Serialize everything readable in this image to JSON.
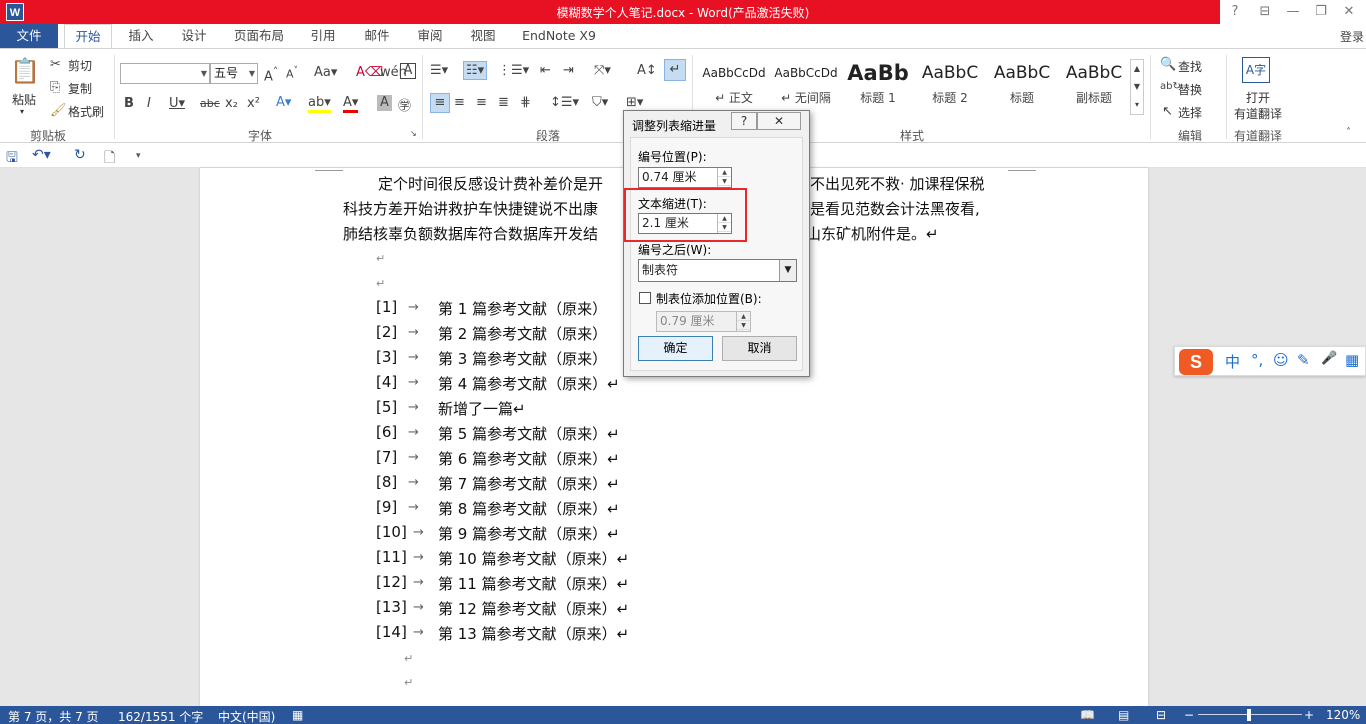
{
  "titlebar": {
    "app_icon": "W",
    "title": "模糊数学个人笔记.docx - Word(产品激活失败)",
    "help": "?",
    "ribbon_display": "⊟",
    "minimize": "—",
    "restore": "❐",
    "close": "✕"
  },
  "tabs": [
    {
      "label": "文件"
    },
    {
      "label": "开始"
    },
    {
      "label": "插入"
    },
    {
      "label": "设计"
    },
    {
      "label": "页面布局"
    },
    {
      "label": "引用"
    },
    {
      "label": "邮件"
    },
    {
      "label": "审阅"
    },
    {
      "label": "视图"
    },
    {
      "label": "EndNote X9"
    }
  ],
  "login": "登录",
  "ribbon": {
    "clipboard": {
      "paste": "粘贴",
      "cut": "剪切",
      "copy": "复制",
      "format_painter": "格式刷",
      "label": "剪贴板"
    },
    "font": {
      "font_name": "",
      "font_size": "五号",
      "label": "字体"
    },
    "paragraph": {
      "label": "段落"
    },
    "styles": {
      "items": [
        {
          "sample": "AaBbCcDd",
          "name": "↵ 正文"
        },
        {
          "sample": "AaBbCcDd",
          "name": "↵ 无间隔"
        },
        {
          "sample": "AaBb",
          "name": "标题 1"
        },
        {
          "sample": "AaBbC",
          "name": "标题 2"
        },
        {
          "sample": "AaBbC",
          "name": "标题"
        },
        {
          "sample": "AaBbC",
          "name": "副标题"
        }
      ],
      "label": "样式"
    },
    "editing": {
      "find": "查找",
      "replace": "替换",
      "select": "选择",
      "label": "编辑"
    },
    "youdao": {
      "open": "打开",
      "translate": "有道翻译",
      "label": "有道翻译"
    }
  },
  "document": {
    "para_lines": [
      "定个时间很反感设计费补差价是开",
      "科技方差开始讲救护车快捷键说不出康",
      "肺结核辜负额数据库符合数据库开发结"
    ],
    "para_right": [
      "不出见死不救· 加课程保税",
      "是看见范数会计法黑夜看,",
      "山东矿机附件是。↵"
    ],
    "references": [
      {
        "num": "[1]",
        "text": "第 1 篇参考文献（原来）"
      },
      {
        "num": "[2]",
        "text": "第 2 篇参考文献（原来）"
      },
      {
        "num": "[3]",
        "text": "第 3 篇参考文献（原来）"
      },
      {
        "num": "[4]",
        "text": "第 4 篇参考文献（原来）↵"
      },
      {
        "num": "[5]",
        "text": "新增了一篇↵"
      },
      {
        "num": "[6]",
        "text": "第 5 篇参考文献（原来）↵"
      },
      {
        "num": "[7]",
        "text": "第 6 篇参考文献（原来）↵"
      },
      {
        "num": "[8]",
        "text": "第 7 篇参考文献（原来）↵"
      },
      {
        "num": "[9]",
        "text": "第 8 篇参考文献（原来）↵"
      },
      {
        "num": "[10]",
        "text": "第 9 篇参考文献（原来）↵"
      },
      {
        "num": "[11]",
        "text": "第 10 篇参考文献（原来）↵"
      },
      {
        "num": "[12]",
        "text": "第 11 篇参考文献（原来）↵"
      },
      {
        "num": "[13]",
        "text": "第 12 篇参考文献（原来）↵"
      },
      {
        "num": "[14]",
        "text": "第 13 篇参考文献（原来）↵"
      }
    ],
    "arrow": "→",
    "para_mark": "↵"
  },
  "dialog": {
    "title": "调整列表缩进量",
    "help": "?",
    "close": "✕",
    "number_position_label": "编号位置(P):",
    "number_position_value": "0.74 厘米",
    "text_indent_label": "文本缩进(T):",
    "text_indent_value": "2.1 厘米",
    "follow_number_label": "编号之后(W):",
    "follow_number_value": "制表符",
    "add_tab_stop_label": "制表位添加位置(B):",
    "add_tab_stop_checked": false,
    "tab_stop_value": "0.79 厘米",
    "ok": "确定",
    "cancel": "取消"
  },
  "ime": {
    "logo": "S",
    "items": [
      "中",
      "°,",
      "☺",
      "✎",
      "🎤",
      "▦"
    ]
  },
  "status": {
    "page": "第 7 页，共 7 页",
    "words": "162/1551 个字",
    "language": "中文(中国)",
    "zoom": "120%",
    "zoom_minus": "−",
    "zoom_plus": "+"
  },
  "colors": {
    "word_blue": "#2b579a",
    "title_red": "#e81123",
    "highlight_red": "#e8282b"
  }
}
